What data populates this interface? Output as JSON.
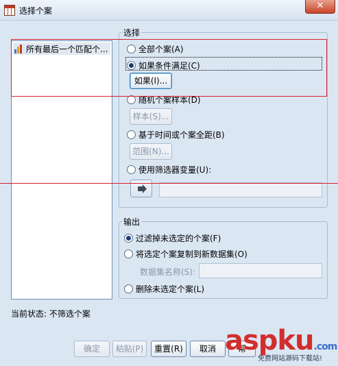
{
  "window": {
    "title": "选择个案",
    "close_glyph": "✕"
  },
  "variable_list": {
    "items": [
      {
        "label": "所有最后一个匹配个..."
      }
    ]
  },
  "select_group": {
    "legend": "选择",
    "options": [
      {
        "label": "全部个案(A)",
        "selected": false
      },
      {
        "label": "如果条件满足(C)",
        "selected": true
      },
      {
        "label": "随机个案样本(D)",
        "selected": false
      },
      {
        "label": "基于时间或个案全距(B)",
        "selected": false
      },
      {
        "label": "使用筛选器变量(U):",
        "selected": false
      }
    ],
    "if_button": "如果(I)...",
    "sample_button": "样本(S)...",
    "range_button": "范围(N)...",
    "filter_variable_value": ""
  },
  "output_group": {
    "legend": "输出",
    "options": [
      {
        "label": "过滤掉未选定的个案(F)",
        "selected": true
      },
      {
        "label": "将选定个案复制到新数据集(O)",
        "selected": false
      },
      {
        "label": "删除未选定个案(L)",
        "selected": false
      }
    ],
    "dataset_name_label": "数据集名称(S):",
    "dataset_name_value": ""
  },
  "status": {
    "text": "当前状态: 不筛选个案"
  },
  "buttons": {
    "ok": "确定",
    "paste": "粘贴(P)",
    "reset": "重置(R)",
    "cancel": "取消",
    "help": "帮"
  },
  "watermark": {
    "main": "aspku",
    "suffix": ".com",
    "sub": "免费网站源码下载站!"
  },
  "colors": {
    "annotation_red": "#d3202a",
    "radio_dot": "#1d3f78",
    "list_selection": "#e1e8f1"
  }
}
